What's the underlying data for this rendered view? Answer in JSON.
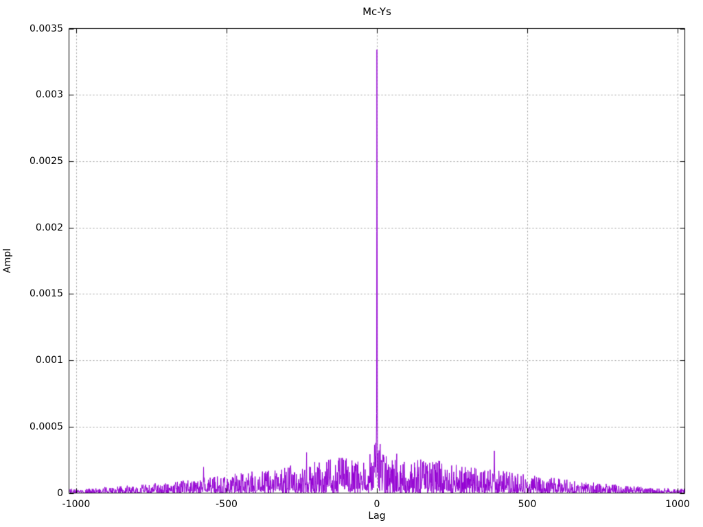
{
  "chart_data": {
    "type": "line",
    "title": "Mc-Ys",
    "xlabel": "Lag",
    "ylabel": "Ampl",
    "xlim": [
      -1025,
      1025
    ],
    "ylim": [
      0,
      0.0035
    ],
    "grid": "dotted",
    "legend_position": "none",
    "background_color": "#ffffff",
    "axis_color": "#000000",
    "grid_color": "#9b9b9b",
    "line_color": "#9400d3",
    "x_ticks": [
      {
        "value": -1000,
        "label": "-1000"
      },
      {
        "value": -500,
        "label": "-500"
      },
      {
        "value": 0,
        "label": "0"
      },
      {
        "value": 500,
        "label": "500"
      },
      {
        "value": 1000,
        "label": "1000"
      }
    ],
    "y_ticks": [
      {
        "value": 0,
        "label": "0"
      },
      {
        "value": 0.0005,
        "label": "0.0005"
      },
      {
        "value": 0.001,
        "label": "0.001"
      },
      {
        "value": 0.0015,
        "label": "0.0015"
      },
      {
        "value": 0.002,
        "label": "0.002"
      },
      {
        "value": 0.0025,
        "label": "0.0025"
      },
      {
        "value": 0.003,
        "label": "0.003"
      },
      {
        "value": 0.0035,
        "label": "0.0035"
      }
    ],
    "series": [
      {
        "name": "Mc-Ys",
        "kind": "autocorrelation",
        "lag_min": -1023,
        "lag_max": 1024,
        "peaks": [
          {
            "lag": 0,
            "value": 0.00334
          },
          {
            "lag": 1,
            "value": 0.0019
          },
          {
            "lag": -1,
            "value": 0.0006
          }
        ],
        "noise_model": {
          "description": "positive noise floor with triangular envelope decaying from center to edges",
          "floor": 3e-05,
          "envelope_max": 0.0003,
          "envelope_power": 1.6,
          "envelope_extent": 1070,
          "value_power": 1.8,
          "center_bump_amp": 0.00026,
          "center_bump_width": 10,
          "outlier_prob": 0.008,
          "outlier_gain": 1.9,
          "seed": 20240917
        }
      }
    ]
  }
}
